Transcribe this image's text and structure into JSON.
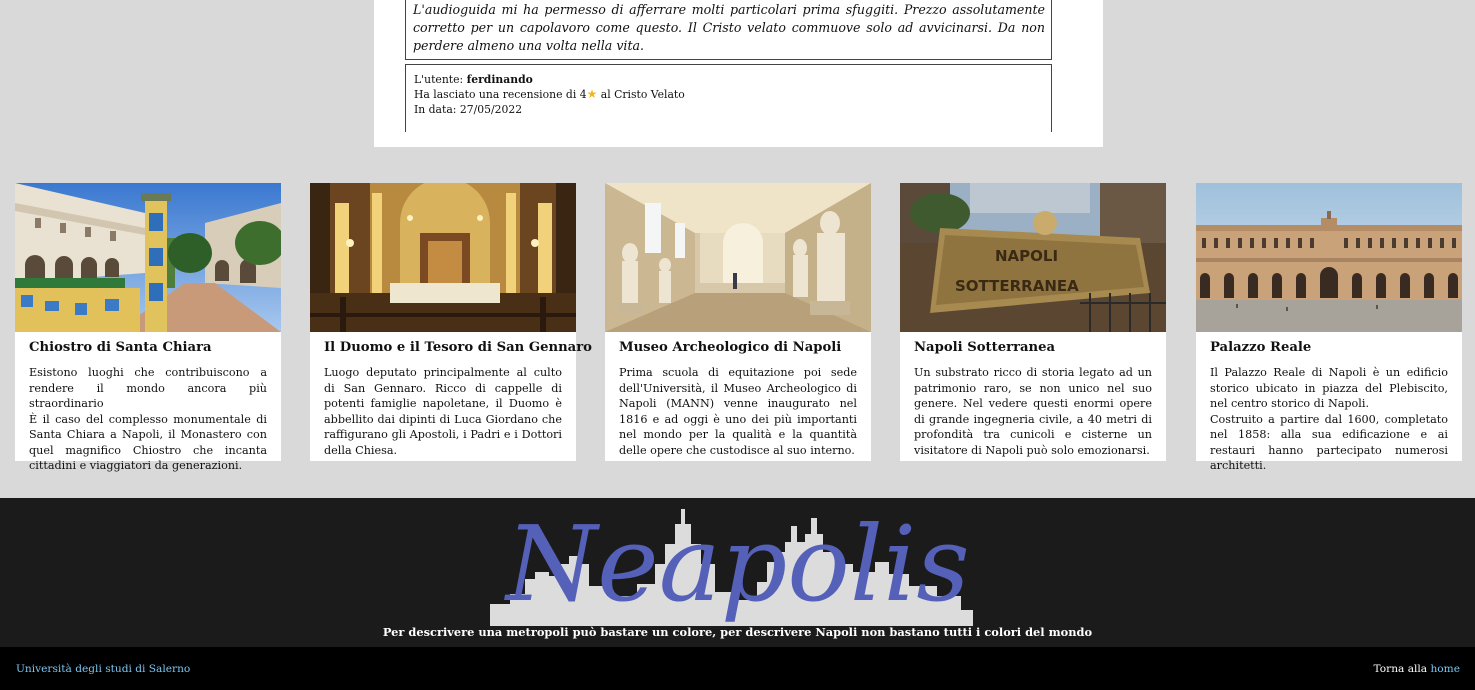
{
  "reviews": {
    "visible_review_text": "L'audioguida mi ha permesso di afferrare molti particolari prima sfuggiti. Prezzo assolutamente corretto per un capolavoro come questo. Il Cristo velato commuove solo ad avvicinarsi. Da non perdere almeno una volta nella vita.",
    "next_review": {
      "user_prefix": "L'utente: ",
      "username": "ferdinando",
      "rating_prefix": "Ha lasciato una recensione di ",
      "rating_value": "4",
      "rating_icon": "star-icon",
      "rating_suffix": " al Cristo Velato",
      "date_prefix": "In data: ",
      "date": "27/05/2022"
    }
  },
  "cards": [
    {
      "title": "Chiostro di Santa Chiara",
      "lines": [
        "Esistono luoghi che contribuiscono a rendere il mondo ancora più straordinario",
        "È il caso del complesso monumentale di Santa Chiara a Napoli, il Monastero con quel magnifico Chiostro che incanta cittadini e viaggiatori da generazioni."
      ],
      "image": "cloister-majolica-photo"
    },
    {
      "title": "Il Duomo e il Tesoro di San Gennaro",
      "lines": [
        "Luogo deputato principalmente al culto di San Gennaro. Ricco di cappelle di potenti famiglie napoletane, il Duomo è abbellito dai dipinti di Luca Giordano che raffigurano gli Apostoli, i Padri e i Dottori della Chiesa."
      ],
      "image": "cathedral-chapel-photo"
    },
    {
      "title": "Museo Archeologico di Napoli",
      "lines": [
        "Prima scuola di equitazione poi sede dell'Università, il Museo Archeologico di Napoli (MANN) venne inaugurato nel 1816 e ad oggi è uno dei più importanti nel mondo per la qualità e la quantità delle opere che custodisce al suo interno."
      ],
      "image": "museum-statues-photo"
    },
    {
      "title": "Napoli Sotterranea",
      "lines": [
        "Un substrato ricco di storia legato ad un patrimonio raro, se non unico nel suo genere. Nel vedere questi enormi opere di grande ingegneria civile, a 40 metri di profondità tra cunicoli e cisterne un visitatore di Napoli può solo emozionarsi."
      ],
      "image": "underground-sign-photo"
    },
    {
      "title": "Palazzo Reale",
      "lines": [
        "Il Palazzo Reale di Napoli è un edificio storico ubicato in piazza del Plebiscito, nel centro storico di Napoli.",
        "Costruito a partire dal 1600, completato nel 1858: alla sua edificazione e ai restauri hanno partecipato numerosi architetti."
      ],
      "image": "royal-palace-photo"
    }
  ],
  "footer": {
    "logo_text": "Neapolis",
    "motto": "Per descrivere una metropoli può bastare un colore, per descrivere Napoli non bastano tutti i colori del mondo",
    "university_link": "Università degli studi di Salerno",
    "back_prefix": "Torna alla ",
    "home_link": "home"
  },
  "colors": {
    "page_bg": "#d9d9d9",
    "footer_bg": "#1b1b1b",
    "bottom_bar_bg": "#000000",
    "link": "#7cc6f0",
    "logo": "#5560b8",
    "skyline": "#dcdcdc",
    "star": "#f2b818"
  }
}
